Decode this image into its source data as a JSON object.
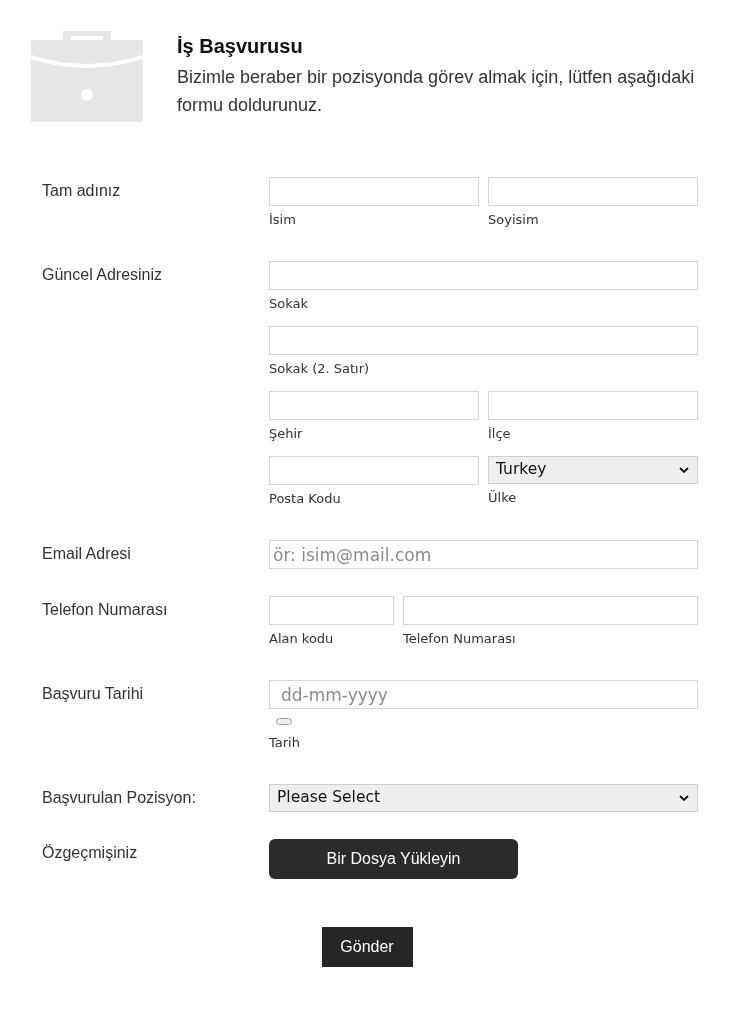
{
  "header": {
    "title": "İş Başvurusu",
    "description": "Bizimle beraber bir pozisyonda görev almak için, lütfen aşağıdaki formu doldurunuz."
  },
  "fields": [
    {
      "label": "Tam adınız",
      "rows": [
        [
          {
            "kind": "text",
            "sublabel": "İsim"
          },
          {
            "kind": "text",
            "sublabel": "Soyisim"
          }
        ]
      ]
    },
    {
      "label": "Güncel Adresiniz",
      "rows": [
        [
          {
            "kind": "text",
            "sublabel": "Sokak"
          }
        ],
        [
          {
            "kind": "text",
            "sublabel": "Sokak (2. Satır)"
          }
        ],
        [
          {
            "kind": "text",
            "sublabel": "Şehir"
          },
          {
            "kind": "text",
            "sublabel": "İlçe"
          }
        ],
        [
          {
            "kind": "text",
            "sublabel": "Posta Kodu"
          },
          {
            "kind": "select",
            "value": "Turkey",
            "sublabel": "Ülke"
          }
        ]
      ]
    },
    {
      "label": "Email Adresi",
      "rows": [
        [
          {
            "kind": "text",
            "placeholder": "ör: isim@mail.com"
          }
        ]
      ]
    },
    {
      "label": "Telefon Numarası",
      "rows": [
        [
          {
            "kind": "short_text",
            "sublabel": "Alan kodu"
          },
          {
            "kind": "text",
            "sublabel": "Telefon Numarası"
          }
        ]
      ]
    },
    {
      "label": "Başvuru Tarihi",
      "rows": [
        [
          {
            "kind": "date",
            "placeholder": "dd-mm-yyyy",
            "sublabel": "Tarih"
          }
        ]
      ]
    },
    {
      "label": "Başvurulan Pozisyon:",
      "rows": [
        [
          {
            "kind": "select",
            "value": "Please Select"
          }
        ]
      ]
    },
    {
      "label": "Özgeçmişiniz",
      "rows": [
        [
          {
            "kind": "upload",
            "button": "Bir Dosya Yükleyin"
          }
        ]
      ]
    }
  ],
  "submit": {
    "label": "Gönder"
  }
}
